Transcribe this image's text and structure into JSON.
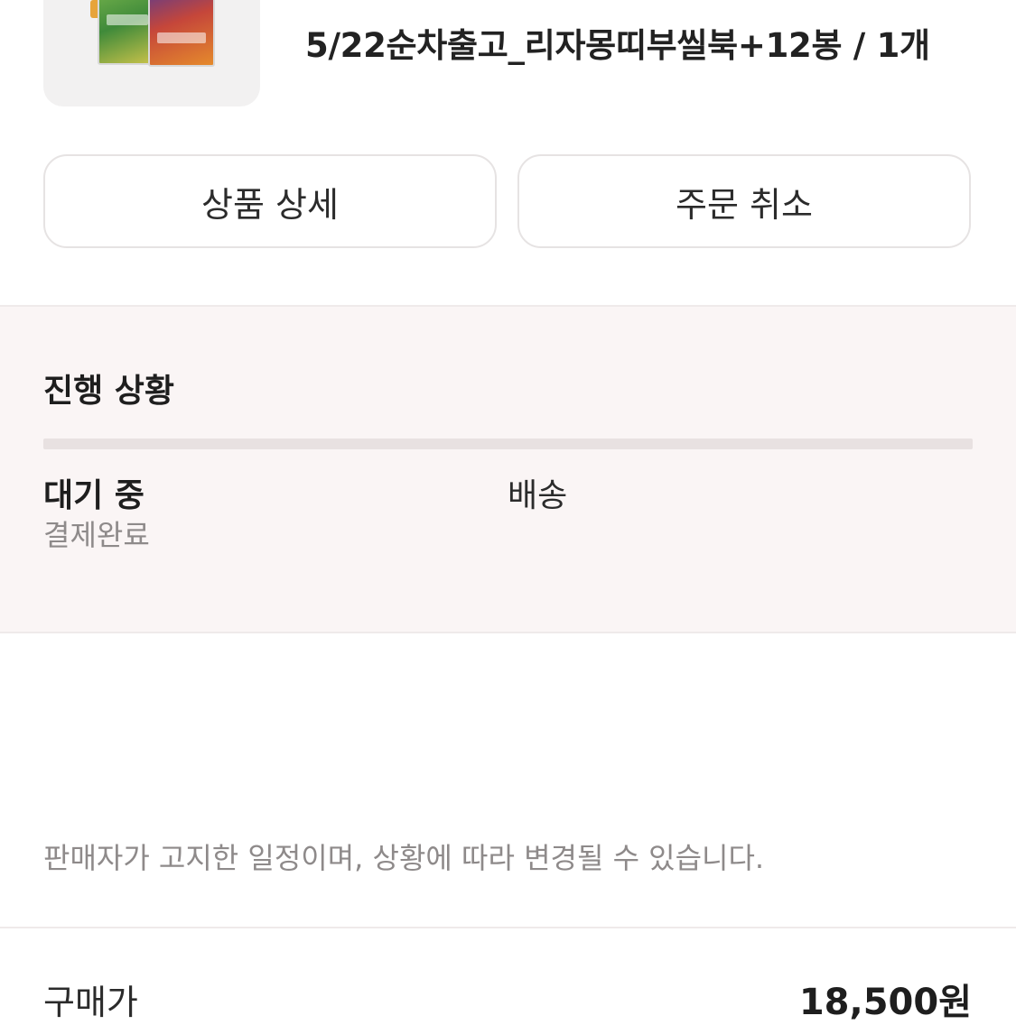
{
  "order_item": {
    "product_title": "5/22순차출고_리자몽띠부씰북+12봉 / 1개"
  },
  "actions": {
    "detail_label": "상품 상세",
    "cancel_label": "주문 취소"
  },
  "progress": {
    "heading": "진행 상황",
    "current_step_title": "대기 중",
    "current_step_subtitle": "결제완료",
    "next_step_title": "배송"
  },
  "notice": "판매자가 고지한 일정이며, 상황에 따라 변경될 수 있습니다.",
  "summary": {
    "price_label": "구매가",
    "price_value": "18,500원"
  },
  "colors": {
    "status_background": "#faf5f5",
    "progress_track": "#e8e1e1",
    "muted_text": "#8e8a8a"
  }
}
